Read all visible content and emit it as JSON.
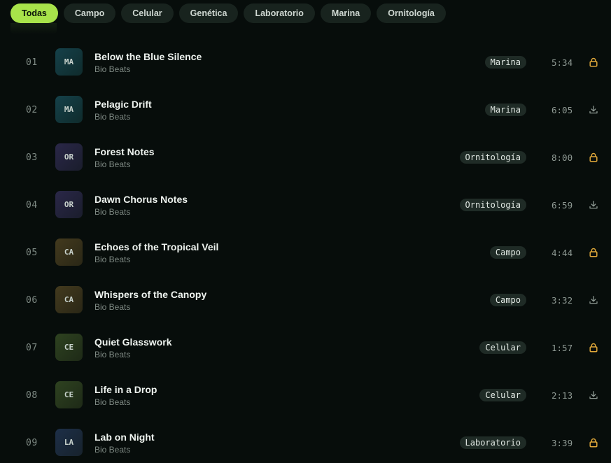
{
  "filters": [
    {
      "label": "Todas",
      "active": true
    },
    {
      "label": "Campo",
      "active": false
    },
    {
      "label": "Celular",
      "active": false
    },
    {
      "label": "Genética",
      "active": false
    },
    {
      "label": "Laboratorio",
      "active": false
    },
    {
      "label": "Marina",
      "active": false
    },
    {
      "label": "Ornitología",
      "active": false
    }
  ],
  "tracks": [
    {
      "number": "01",
      "abbr": "MA",
      "title": "Below the Blue Silence",
      "artist": "Bio Beats",
      "tag": "Marina",
      "duration": "5:34",
      "action": "lock-icon"
    },
    {
      "number": "02",
      "abbr": "MA",
      "title": "Pelagic Drift",
      "artist": "Bio Beats",
      "tag": "Marina",
      "duration": "6:05",
      "action": "download-icon"
    },
    {
      "number": "03",
      "abbr": "OR",
      "title": "Forest Notes",
      "artist": "Bio Beats",
      "tag": "Ornitología",
      "duration": "8:00",
      "action": "lock-icon"
    },
    {
      "number": "04",
      "abbr": "OR",
      "title": "Dawn Chorus Notes",
      "artist": "Bio Beats",
      "tag": "Ornitología",
      "duration": "6:59",
      "action": "download-icon"
    },
    {
      "number": "05",
      "abbr": "CA",
      "title": "Echoes of the Tropical Veil",
      "artist": "Bio Beats",
      "tag": "Campo",
      "duration": "4:44",
      "action": "lock-icon"
    },
    {
      "number": "06",
      "abbr": "CA",
      "title": "Whispers of the Canopy",
      "artist": "Bio Beats",
      "tag": "Campo",
      "duration": "3:32",
      "action": "download-icon"
    },
    {
      "number": "07",
      "abbr": "CE",
      "title": "Quiet Glasswork",
      "artist": "Bio Beats",
      "tag": "Celular",
      "duration": "1:57",
      "action": "lock-icon"
    },
    {
      "number": "08",
      "abbr": "CE",
      "title": "Life in a Drop",
      "artist": "Bio Beats",
      "tag": "Celular",
      "duration": "2:13",
      "action": "download-icon"
    },
    {
      "number": "09",
      "abbr": "LA",
      "title": "Lab on Night",
      "artist": "Bio Beats",
      "tag": "Laboratorio",
      "duration": "3:39",
      "action": "lock-icon"
    }
  ],
  "colors": {
    "accent": "#a8e34a",
    "lock": "#e0a83a",
    "download": "#8e9993",
    "background": "#070d0b"
  }
}
